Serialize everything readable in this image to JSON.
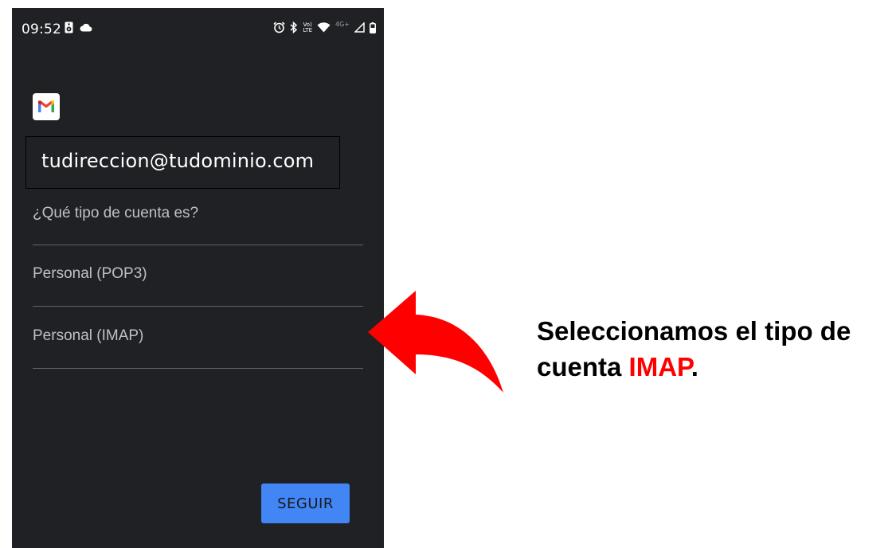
{
  "statusbar": {
    "time": "09:52",
    "volte_top": "Vo)",
    "volte_bottom": "LTE",
    "network": "4G+"
  },
  "app": {
    "logo_icon": "gmail-icon",
    "email": "tudireccion@tudominio.com",
    "question": "¿Qué tipo de cuenta es?",
    "options": [
      {
        "label": "Personal (POP3)"
      },
      {
        "label": "Personal (IMAP)"
      }
    ],
    "next_button_label": "SEGUIR"
  },
  "annotation": {
    "line1": "Seleccionamos el tipo de",
    "line2_prefix": "cuenta ",
    "line2_highlight": "IMAP",
    "line2_suffix": ".",
    "highlight_color": "#ff0000"
  },
  "colors": {
    "phone_background": "#202124",
    "button": "#4285f4",
    "arrow": "#ff0000"
  }
}
